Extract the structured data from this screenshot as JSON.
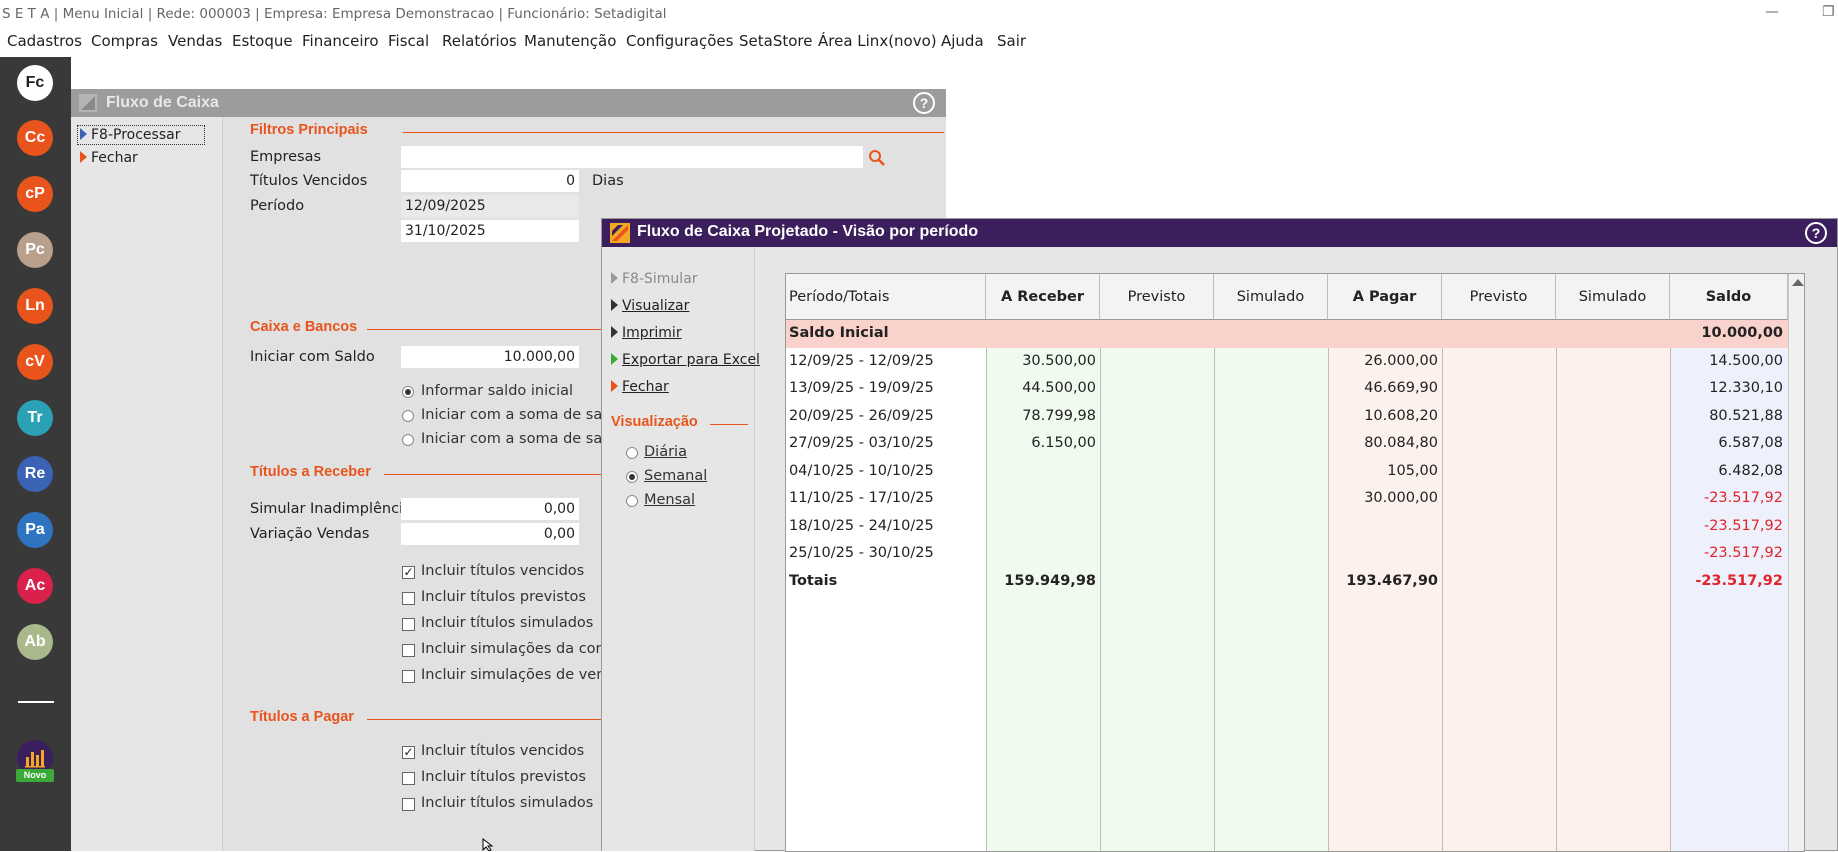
{
  "app": {
    "title": "S E T A | Menu Inicial | Rede: 000003 | Empresa: Empresa Demonstracao | Funcionário: Setadigital",
    "minimize_glyph": "—",
    "restore_glyph": "❐"
  },
  "menu": [
    "Cadastros",
    "Compras",
    "Vendas",
    "Estoque",
    "Financeiro",
    "Fiscal",
    "Relatórios",
    "Manutenção",
    "Configurações",
    "SetaStore",
    "Área Linx(novo)",
    "Ajuda",
    "Sair"
  ],
  "dock": {
    "items": [
      {
        "label": "Fc",
        "color": "#ffffff",
        "text_color": "#222222"
      },
      {
        "label": "Cc",
        "color": "#e8541c",
        "text_color": "#ffffff"
      },
      {
        "label": "cP",
        "color": "#e8541c",
        "text_color": "#ffffff"
      },
      {
        "label": "Pc",
        "color": "#b9a08c",
        "text_color": "#ffffff"
      },
      {
        "label": "Ln",
        "color": "#e8541c",
        "text_color": "#ffffff"
      },
      {
        "label": "cV",
        "color": "#e8541c",
        "text_color": "#ffffff"
      },
      {
        "label": "Tr",
        "color": "#2aa1b5",
        "text_color": "#ffffff"
      },
      {
        "label": "Re",
        "color": "#3a62b5",
        "text_color": "#ffffff"
      },
      {
        "label": "Pa",
        "color": "#2f74c0",
        "text_color": "#ffffff"
      },
      {
        "label": "Ac",
        "color": "#d9214b",
        "text_color": "#ffffff"
      },
      {
        "label": "Ab",
        "color": "#a9b98c",
        "text_color": "#ffffff"
      }
    ],
    "novo_label": "Novo"
  },
  "fluxo": {
    "title": "Fluxo de Caixa",
    "help": "?",
    "actions": {
      "processar": "F8-Processar",
      "fechar": "Fechar"
    },
    "filtros": {
      "header": "Filtros Principais",
      "empresas_label": "Empresas",
      "empresas_value": "",
      "titulos_vencidos_label": "Títulos Vencidos",
      "titulos_vencidos_value": "0",
      "dias_label": "Dias",
      "periodo_label": "Período",
      "periodo_inicio": "12/09/2025",
      "periodo_fim": "31/10/2025"
    },
    "caixa": {
      "header": "Caixa e Bancos",
      "iniciar_label": "Iniciar com Saldo",
      "iniciar_value": "10.000,00",
      "opt1": "Informar saldo inicial",
      "opt2": "Iniciar com a soma de saldo",
      "opt3": "Iniciar com a soma de saldo"
    },
    "receber": {
      "header": "Títulos a Receber",
      "inadimplencia_label": "Simular Inadimplência",
      "inadimplencia_value": "0,00",
      "variacao_label": "Variação Vendas",
      "variacao_value": "0,00",
      "chk1": "Incluir títulos vencidos",
      "chk2": "Incluir títulos previstos",
      "chk3": "Incluir títulos simulados",
      "chk4": "Incluir simulações da corre",
      "chk5": "Incluir simulações de venda"
    },
    "pagar": {
      "header": "Títulos a Pagar",
      "chk1": "Incluir títulos vencidos",
      "chk2": "Incluir títulos previstos",
      "chk3": "Incluir títulos simulados"
    }
  },
  "projetado": {
    "title": "Fluxo de Caixa Projetado - Visão por período",
    "help": "?",
    "actions": {
      "simular": "F8-Simular",
      "visualizar": "Visualizar",
      "imprimir": "Imprimir",
      "exportar": "Exportar para Excel",
      "fechar": "Fechar"
    },
    "visualizacao": {
      "header": "Visualização",
      "diaria": "Diária",
      "semanal": "Semanal",
      "mensal": "Mensal"
    },
    "columns": [
      "Período/Totais",
      "A Receber",
      "Previsto",
      "Simulado",
      "A Pagar",
      "Previsto",
      "Simulado",
      "Saldo"
    ],
    "saldo_inicial": {
      "label": "Saldo Inicial",
      "saldo": "10.000,00"
    },
    "rows": [
      {
        "periodo": "12/09/25 - 12/09/25",
        "receber": "30.500,00",
        "pagar": "26.000,00",
        "saldo": "14.500,00"
      },
      {
        "periodo": "13/09/25 - 19/09/25",
        "receber": "44.500,00",
        "pagar": "46.669,90",
        "saldo": "12.330,10"
      },
      {
        "periodo": "20/09/25 - 26/09/25",
        "receber": "78.799,98",
        "pagar": "10.608,20",
        "saldo": "80.521,88"
      },
      {
        "periodo": "27/09/25 - 03/10/25",
        "receber": "6.150,00",
        "pagar": "80.084,80",
        "saldo": "6.587,08"
      },
      {
        "periodo": "04/10/25 - 10/10/25",
        "receber": "",
        "pagar": "105,00",
        "saldo": "6.482,08"
      },
      {
        "periodo": "11/10/25 - 17/10/25",
        "receber": "",
        "pagar": "30.000,00",
        "saldo": "-23.517,92"
      },
      {
        "periodo": "18/10/25 - 24/10/25",
        "receber": "",
        "pagar": "",
        "saldo": "-23.517,92"
      },
      {
        "periodo": "25/10/25 - 30/10/25",
        "receber": "",
        "pagar": "",
        "saldo": "-23.517,92"
      }
    ],
    "totais": {
      "label": "Totais",
      "receber": "159.949,98",
      "pagar": "193.467,90",
      "saldo": "-23.517,92"
    }
  }
}
